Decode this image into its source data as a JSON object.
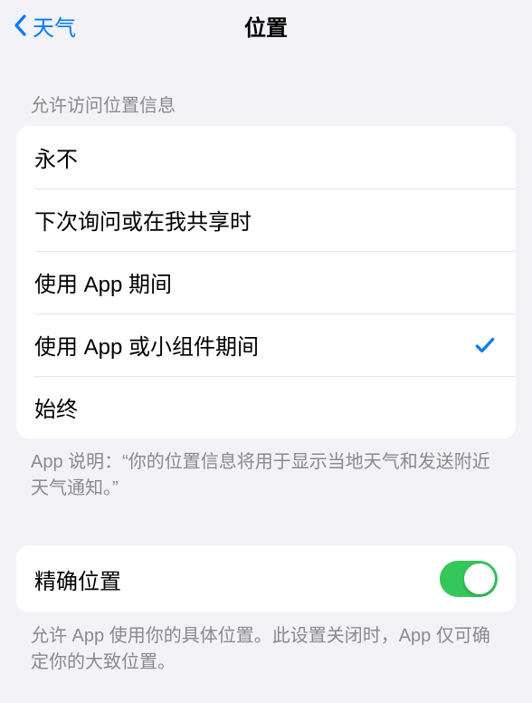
{
  "nav": {
    "back_label": "天气",
    "title": "位置"
  },
  "access_section": {
    "header": "允许访问位置信息",
    "options": [
      {
        "label": "永不",
        "selected": false
      },
      {
        "label": "下次询问或在我共享时",
        "selected": false
      },
      {
        "label": "使用 App 期间",
        "selected": false
      },
      {
        "label": "使用 App 或小组件期间",
        "selected": true
      },
      {
        "label": "始终",
        "selected": false
      }
    ],
    "footer": "App 说明：“你的位置信息将用于显示当地天气和发送附近天气通知。”"
  },
  "precise_section": {
    "row_label": "精确位置",
    "enabled": true,
    "footer": "允许 App 使用你的具体位置。此设置关闭时，App 仅可确定你的大致位置。"
  }
}
